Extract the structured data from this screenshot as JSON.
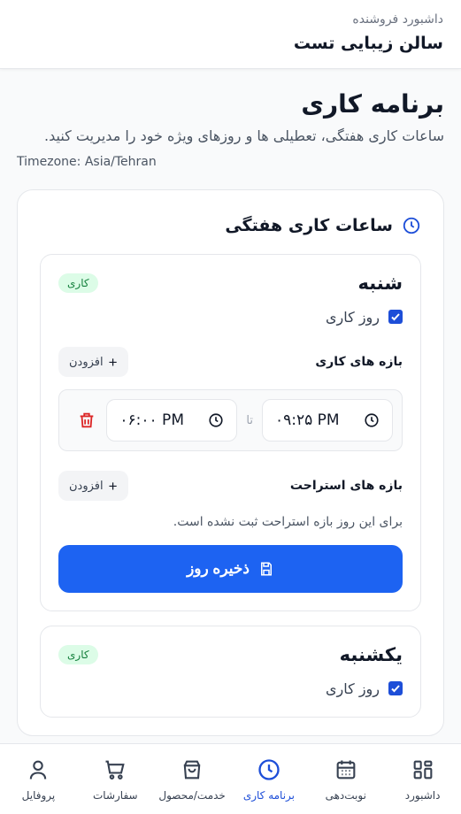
{
  "header": {
    "subtitle": "داشبورد فروشنده",
    "title": "سالن زیبایی تست"
  },
  "page": {
    "title": "برنامه کاری",
    "description": "ساعات کاری هفتگی، تعطیلی ها و روزهای ویژه خود را مدیریت کنید.",
    "timezone": "Timezone: Asia/Tehran"
  },
  "weekly": {
    "title": "ساعات کاری هفتگی",
    "days": [
      {
        "name": "شنبه",
        "badge": "کاری",
        "working_label": "روز کاری",
        "working": true,
        "intervals_label": "بازه های کاری",
        "add_label": "افزودن",
        "interval": {
          "start": "۰۹:۲۵ PM",
          "end": "۰۶:۰۰ PM",
          "to": "تا"
        },
        "breaks_label": "بازه های استراحت",
        "breaks_empty": "برای این روز بازه استراحت ثبت نشده است.",
        "save_label": "ذخیره روز"
      },
      {
        "name": "یکشنبه",
        "badge": "کاری",
        "working_label": "روز کاری",
        "working": true
      }
    ]
  },
  "nav": [
    {
      "label": "داشبورد",
      "icon": "grid-icon"
    },
    {
      "label": "نوبت‌دهی",
      "icon": "calendar-icon"
    },
    {
      "label": "برنامه کاری",
      "icon": "clock-icon",
      "active": true
    },
    {
      "label": "خدمت/محصول",
      "icon": "bag-icon"
    },
    {
      "label": "سفارشات",
      "icon": "cart-icon"
    },
    {
      "label": "پروفایل",
      "icon": "user-icon"
    }
  ],
  "colors": {
    "primary": "#1d63f2",
    "active_nav": "#1d4ed8",
    "badge_bg": "#dcfce7",
    "badge_text": "#15803d",
    "danger": "#dc2626"
  }
}
